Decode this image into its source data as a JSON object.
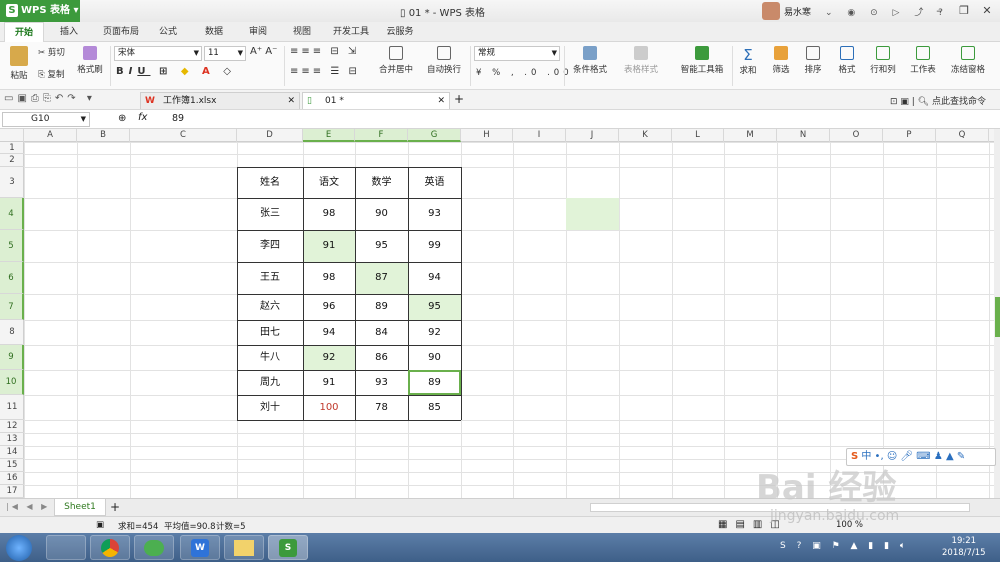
{
  "app": {
    "name": "WPS 表格",
    "title": "01 * - WPS 表格",
    "user": "易水寒"
  },
  "tabs": [
    "开始",
    "插入",
    "页面布局",
    "公式",
    "数据",
    "审阅",
    "视图",
    "开发工具",
    "云服务"
  ],
  "ribbon": {
    "paste": "粘贴",
    "cut": "剪切",
    "copy": "复制",
    "format_painter": "格式刷",
    "font_name": "宋体",
    "font_size": "11",
    "merge": "合并居中",
    "wrap": "自动换行",
    "number_format": "常规",
    "conditional": "条件格式",
    "table_style": "表格样式",
    "smart_toolbox": "智能工具箱",
    "sum": "求和",
    "filter": "筛选",
    "sort": "排序",
    "format": "格式",
    "rowcol": "行和列",
    "worksheet": "工作表",
    "freeze": "冻结窗格"
  },
  "doc_tabs": [
    "工作簿1.xlsx",
    "01 *"
  ],
  "search_label": "点此查找命令",
  "formula": {
    "cell_ref": "G10",
    "fx": "fx",
    "value": "89"
  },
  "columns": [
    "A",
    "B",
    "C",
    "D",
    "E",
    "F",
    "G",
    "H",
    "I",
    "J",
    "K",
    "L",
    "M",
    "N",
    "O",
    "P",
    "Q"
  ],
  "rows": [
    "1",
    "2",
    "3",
    "4",
    "5",
    "6",
    "7",
    "8",
    "9",
    "10",
    "11",
    "12",
    "13",
    "14",
    "15",
    "16",
    "17"
  ],
  "table": {
    "headers": [
      "姓名",
      "语文",
      "数学",
      "英语"
    ],
    "data": [
      [
        "张三",
        "98",
        "90",
        "93"
      ],
      [
        "李四",
        "91",
        "95",
        "99"
      ],
      [
        "王五",
        "98",
        "87",
        "94"
      ],
      [
        "赵六",
        "96",
        "89",
        "95"
      ],
      [
        "田七",
        "94",
        "84",
        "92"
      ],
      [
        "牛八",
        "92",
        "86",
        "90"
      ],
      [
        "周九",
        "91",
        "93",
        "89"
      ],
      [
        "刘十",
        "100",
        "78",
        "85"
      ]
    ]
  },
  "sheet_tab": "Sheet1",
  "status": {
    "sum": "求和=454",
    "avg": "平均值=90.8",
    "count": "计数=5",
    "zoom": "100 %"
  },
  "clock": {
    "time": "19:21",
    "date": "2018/7/15"
  },
  "watermark": {
    "main": "Bai 经验",
    "sub": "jingyan.baidu.com"
  },
  "colors": {
    "accent": "#3c9a3c",
    "highlight": "#e1f3d8",
    "red_text": "#c0392b"
  }
}
